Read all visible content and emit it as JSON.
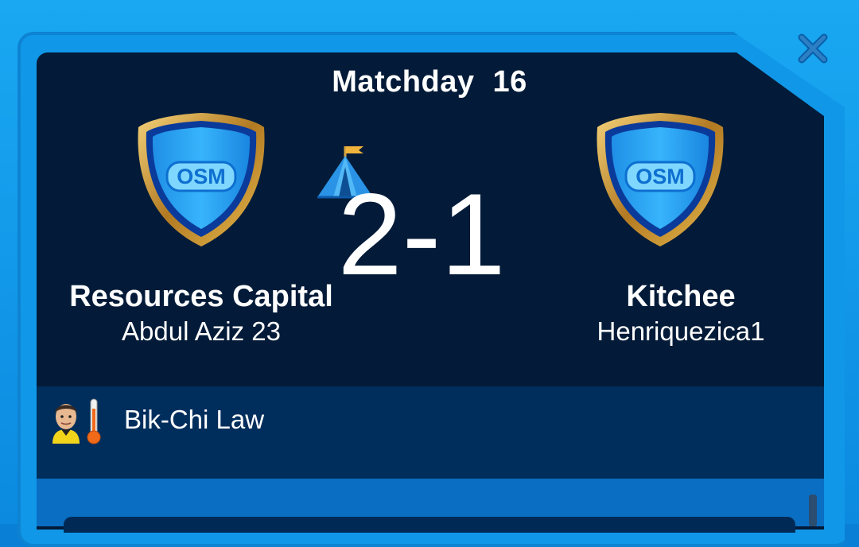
{
  "header": {
    "matchday_label": "Matchday",
    "matchday_number": "16"
  },
  "match": {
    "score": "2-1",
    "home": {
      "team": "Resources Capital",
      "manager": "Abdul Aziz 23",
      "crest_text": "OSM"
    },
    "away": {
      "team": "Kitchee",
      "manager": "Henriquezica1",
      "crest_text": "OSM"
    },
    "venue_icon": "tent-icon"
  },
  "referee": {
    "name": "Bik-Chi Law",
    "avatar_icon": "referee-avatar-icon",
    "strictness_icon": "thermometer-icon"
  },
  "colors": {
    "frame": "#1097e8",
    "panel": "#031b38",
    "referee_row": "#002e5c",
    "accent": "#ffffff"
  }
}
